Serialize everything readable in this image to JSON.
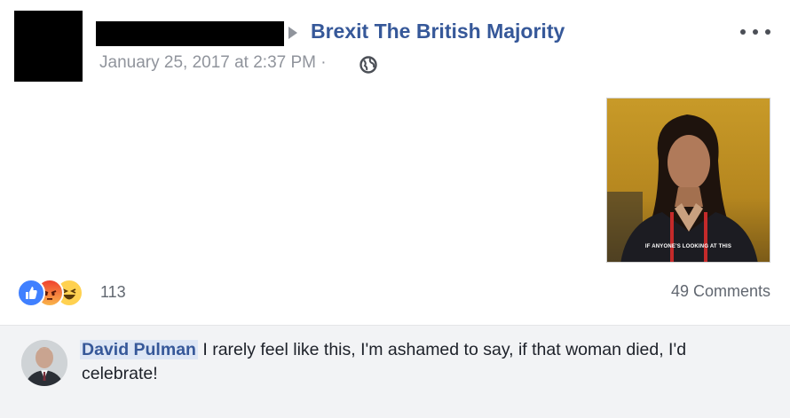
{
  "post": {
    "group_name": "Brexit The British Majority",
    "timestamp": "January 25, 2017 at 2:37 PM · ",
    "privacy_icon": "globe-icon",
    "more_icon": "more-options-icon",
    "gif": {
      "caption": "IF ANYONE'S LOOKING AT THIS"
    }
  },
  "reactions": {
    "icons": [
      "like-icon",
      "angry-icon",
      "haha-icon"
    ],
    "count": "113"
  },
  "comments_count": "49 Comments",
  "comment": {
    "author": "David Pulman",
    "text": "I rarely feel like this, I'm ashamed to say, if that woman died, I'd celebrate!"
  },
  "colors": {
    "link": "#365899",
    "meta": "#90949c",
    "comment_bg": "#f2f3f5",
    "like": "#4080ff"
  }
}
